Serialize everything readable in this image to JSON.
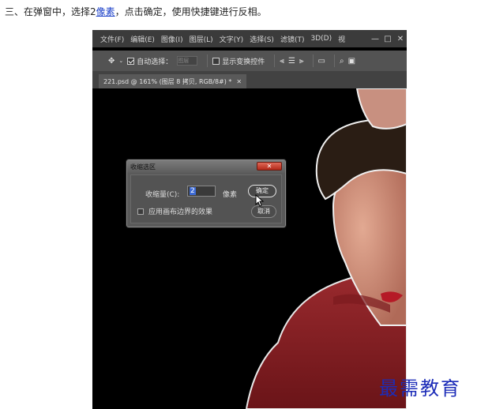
{
  "instruction": {
    "before": "三、在弹窗中，选择2",
    "link": "像素",
    "after": "，点击确定，使用快捷键进行反相。"
  },
  "menubar": {
    "items": [
      "文件(F)",
      "编辑(E)",
      "图像(I)",
      "图层(L)",
      "文字(Y)",
      "选择(S)",
      "滤镜(T)",
      "3D(D)",
      "视"
    ],
    "minimize": "—",
    "maximize": "□",
    "close": "✕"
  },
  "options": {
    "auto_select_label": "自动选择：",
    "auto_select_value": "图层",
    "show_transform_label": "显示变换控件"
  },
  "document_tab": {
    "title": "221.psd @ 161% (图层 8 拷贝, RGB/8#) *",
    "close": "✕"
  },
  "dialog": {
    "title": "收缩选区",
    "close_label": "✕",
    "amount_label": "收缩量(C):",
    "amount_value": "2",
    "unit": "像素",
    "ok_label": "确定",
    "cancel_label": "取消",
    "canvas_effect_label": "应用画布边界的效果",
    "canvas_effect_checked": false
  },
  "watermark": "最需教育",
  "colors": {
    "link": "#1a3fc8",
    "sweater": "#8a1f25",
    "watermark": "#1c2cb8"
  }
}
